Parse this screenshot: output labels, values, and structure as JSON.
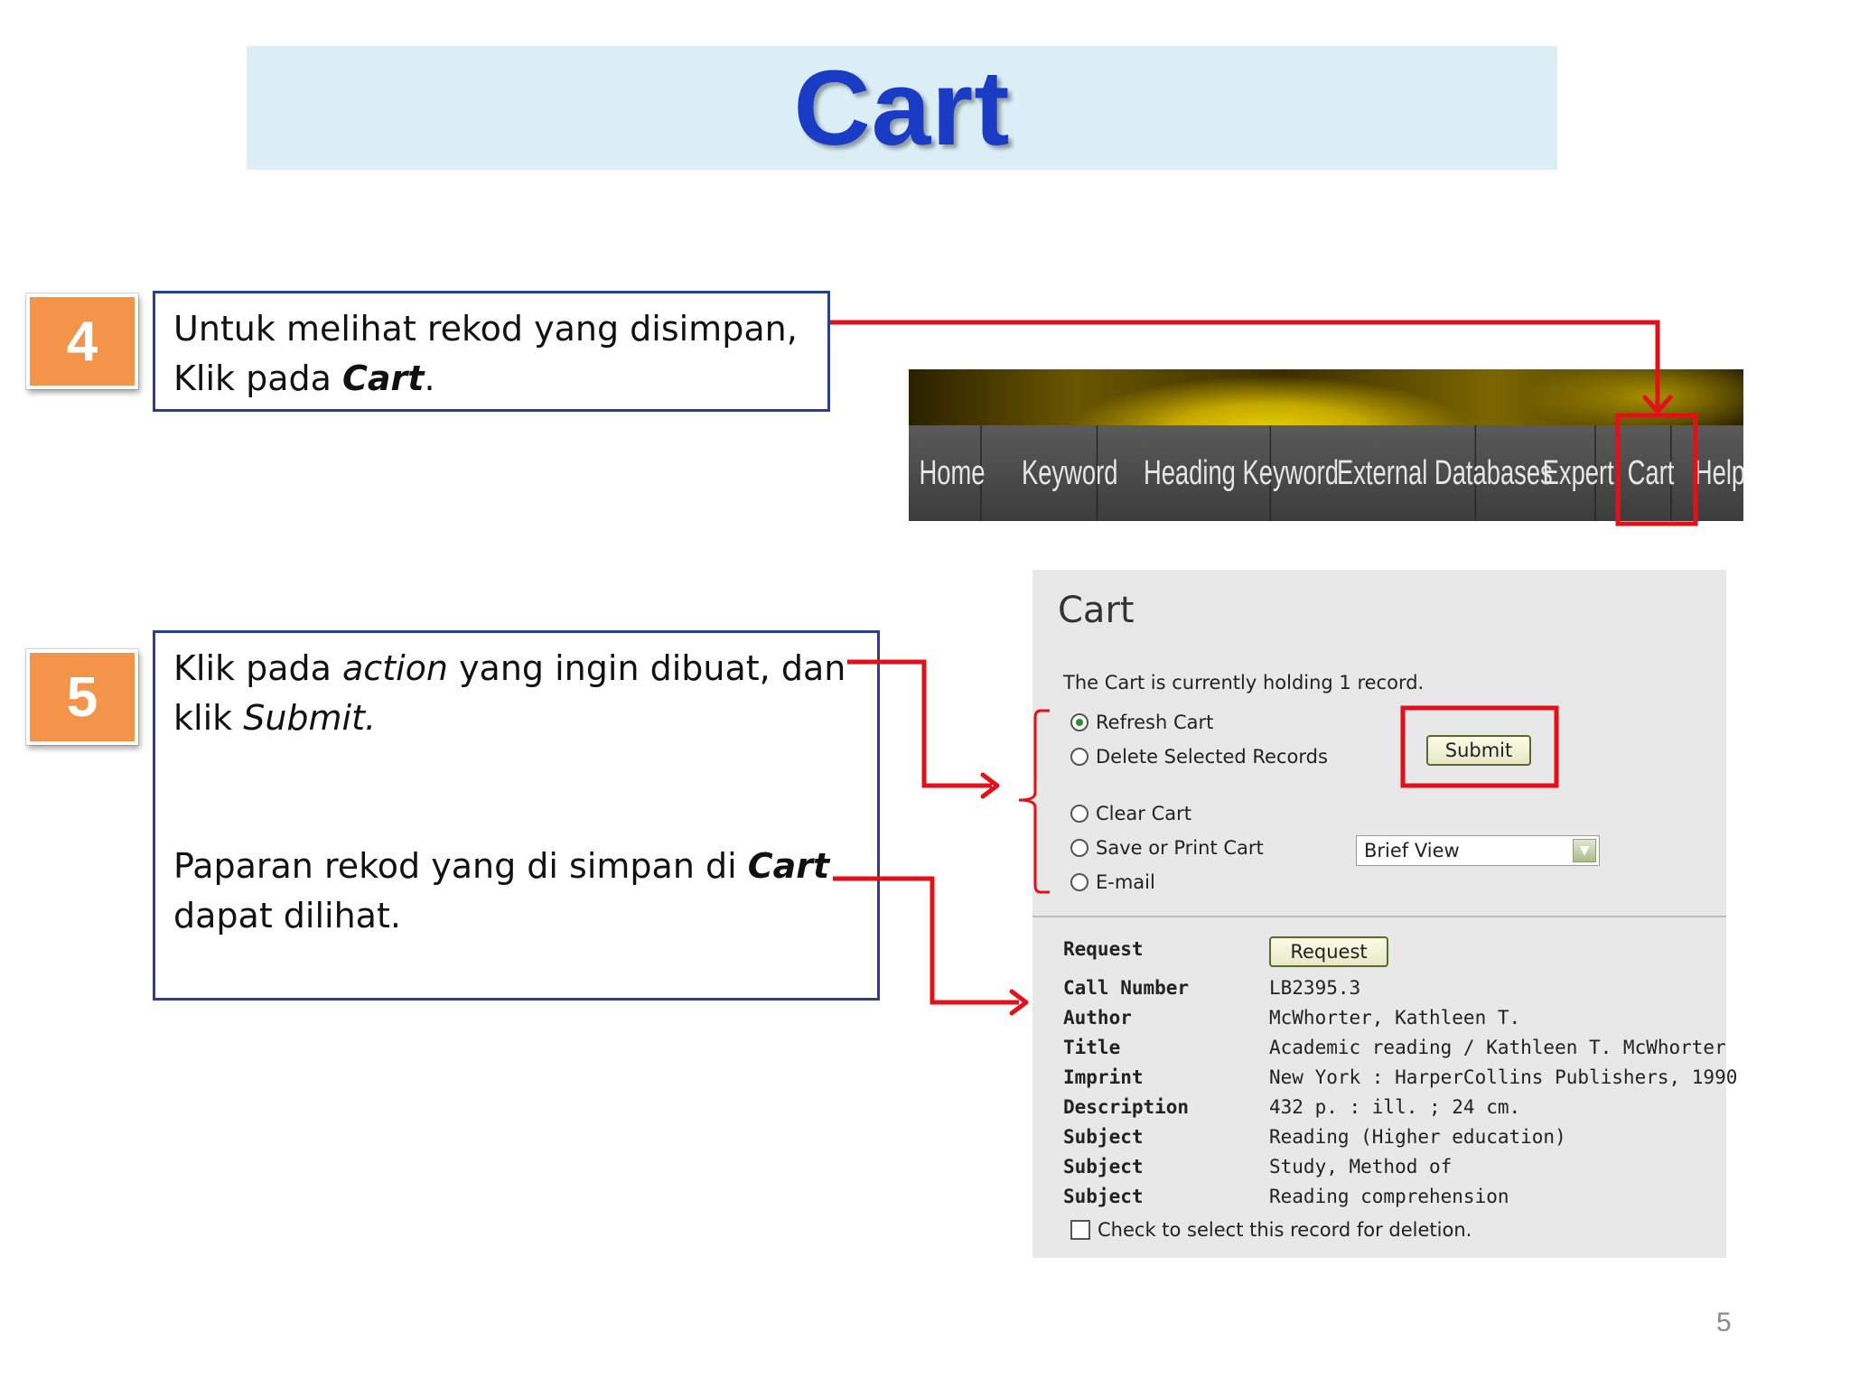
{
  "slide": {
    "title": "Cart",
    "page_number": "5"
  },
  "steps": [
    {
      "number": "4",
      "lines": [
        {
          "text": "Untuk melihat rekod yang disimpan,"
        },
        {
          "prefix": "Klik pada ",
          "bold_italic": "Cart",
          "suffix": "."
        }
      ]
    },
    {
      "number": "5",
      "line1_prefix": "Klik pada ",
      "line1_italic": "action",
      "line1_suffix": " yang ingin dibuat, dan",
      "line2_prefix": "klik ",
      "line2_italic": "Submit.",
      "line3_prefix": "Paparan rekod  yang di simpan di ",
      "line3_bold_italic": "Cart",
      "line4": "dapat dilihat."
    }
  ],
  "nav": {
    "items": [
      "Home",
      "Keyword",
      "Heading Keyword",
      "External Databases",
      "Expert",
      "Cart",
      "Help"
    ],
    "highlighted": "Cart"
  },
  "cart": {
    "heading": "Cart",
    "status": "The Cart is currently holding 1 record.",
    "options": [
      {
        "label": "Refresh Cart",
        "checked": true
      },
      {
        "label": "Delete Selected Records",
        "checked": false
      },
      {
        "label": "Clear Cart",
        "checked": false
      },
      {
        "label": "Save or Print Cart",
        "checked": false
      },
      {
        "label": "E-mail",
        "checked": false
      }
    ],
    "submit_label": "Submit",
    "view_select": "Brief View",
    "request_label": "Request",
    "request_button": "Request",
    "record": [
      {
        "label": "Call Number",
        "value": "LB2395.3"
      },
      {
        "label": "Author",
        "value": "McWhorter, Kathleen T."
      },
      {
        "label": "Title",
        "value": "Academic reading / Kathleen T. McWhorter"
      },
      {
        "label": "Imprint",
        "value": "New York : HarperCollins Publishers, 1990"
      },
      {
        "label": "Description",
        "value": "432 p. : ill. ; 24 cm."
      },
      {
        "label": "Subject",
        "value": "Reading (Higher education)"
      },
      {
        "label": "Subject",
        "value": "Study, Method of"
      },
      {
        "label": "Subject",
        "value": "Reading comprehension"
      }
    ],
    "delete_checkbox_label": "Check to select this record for deletion."
  },
  "colors": {
    "title": "#1a3bc4",
    "banner": "#dbeef6",
    "badge": "#f4934a",
    "annotation": "#e3101a",
    "box_border": "#2a3f8f"
  }
}
